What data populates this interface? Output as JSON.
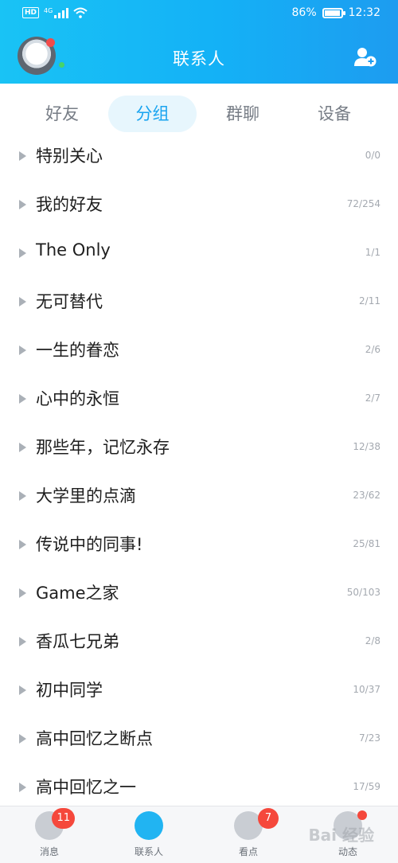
{
  "status": {
    "network": "4G",
    "hd": "HD",
    "battery": "86%",
    "time": "12:32"
  },
  "header": {
    "title": "联系人"
  },
  "tabs": [
    {
      "label": "好友",
      "active": false
    },
    {
      "label": "分组",
      "active": true
    },
    {
      "label": "群聊",
      "active": false
    },
    {
      "label": "设备",
      "active": false
    }
  ],
  "groups": [
    {
      "name": "特别关心",
      "count": "0/0"
    },
    {
      "name": "我的好友",
      "count": "72/254"
    },
    {
      "name": "The Only",
      "count": "1/1"
    },
    {
      "name": "无可替代",
      "count": "2/11"
    },
    {
      "name": "一生的眷恋",
      "count": "2/6"
    },
    {
      "name": "心中的永恒",
      "count": "2/7"
    },
    {
      "name": "那些年，记忆永存",
      "count": "12/38"
    },
    {
      "name": "大学里的点滴",
      "count": "23/62"
    },
    {
      "name": "传说中的同事!",
      "count": "25/81"
    },
    {
      "name": "Game之家",
      "count": "50/103"
    },
    {
      "name": "香瓜七兄弟",
      "count": "2/8"
    },
    {
      "name": "初中同学",
      "count": "10/37"
    },
    {
      "name": "高中回忆之断点",
      "count": "7/23"
    },
    {
      "name": "高中回忆之一",
      "count": "17/59"
    }
  ],
  "nav": {
    "messages": {
      "label": "消息",
      "badge": "11"
    },
    "contacts": {
      "label": "联系人"
    },
    "watch": {
      "label": "看点",
      "badge": "7"
    },
    "feed": {
      "label": "动态"
    }
  },
  "watermark": "Bai 经验",
  "colors": {
    "accent": "#19a4f0",
    "header_start": "#19c3f5",
    "badge": "#f5483c"
  }
}
